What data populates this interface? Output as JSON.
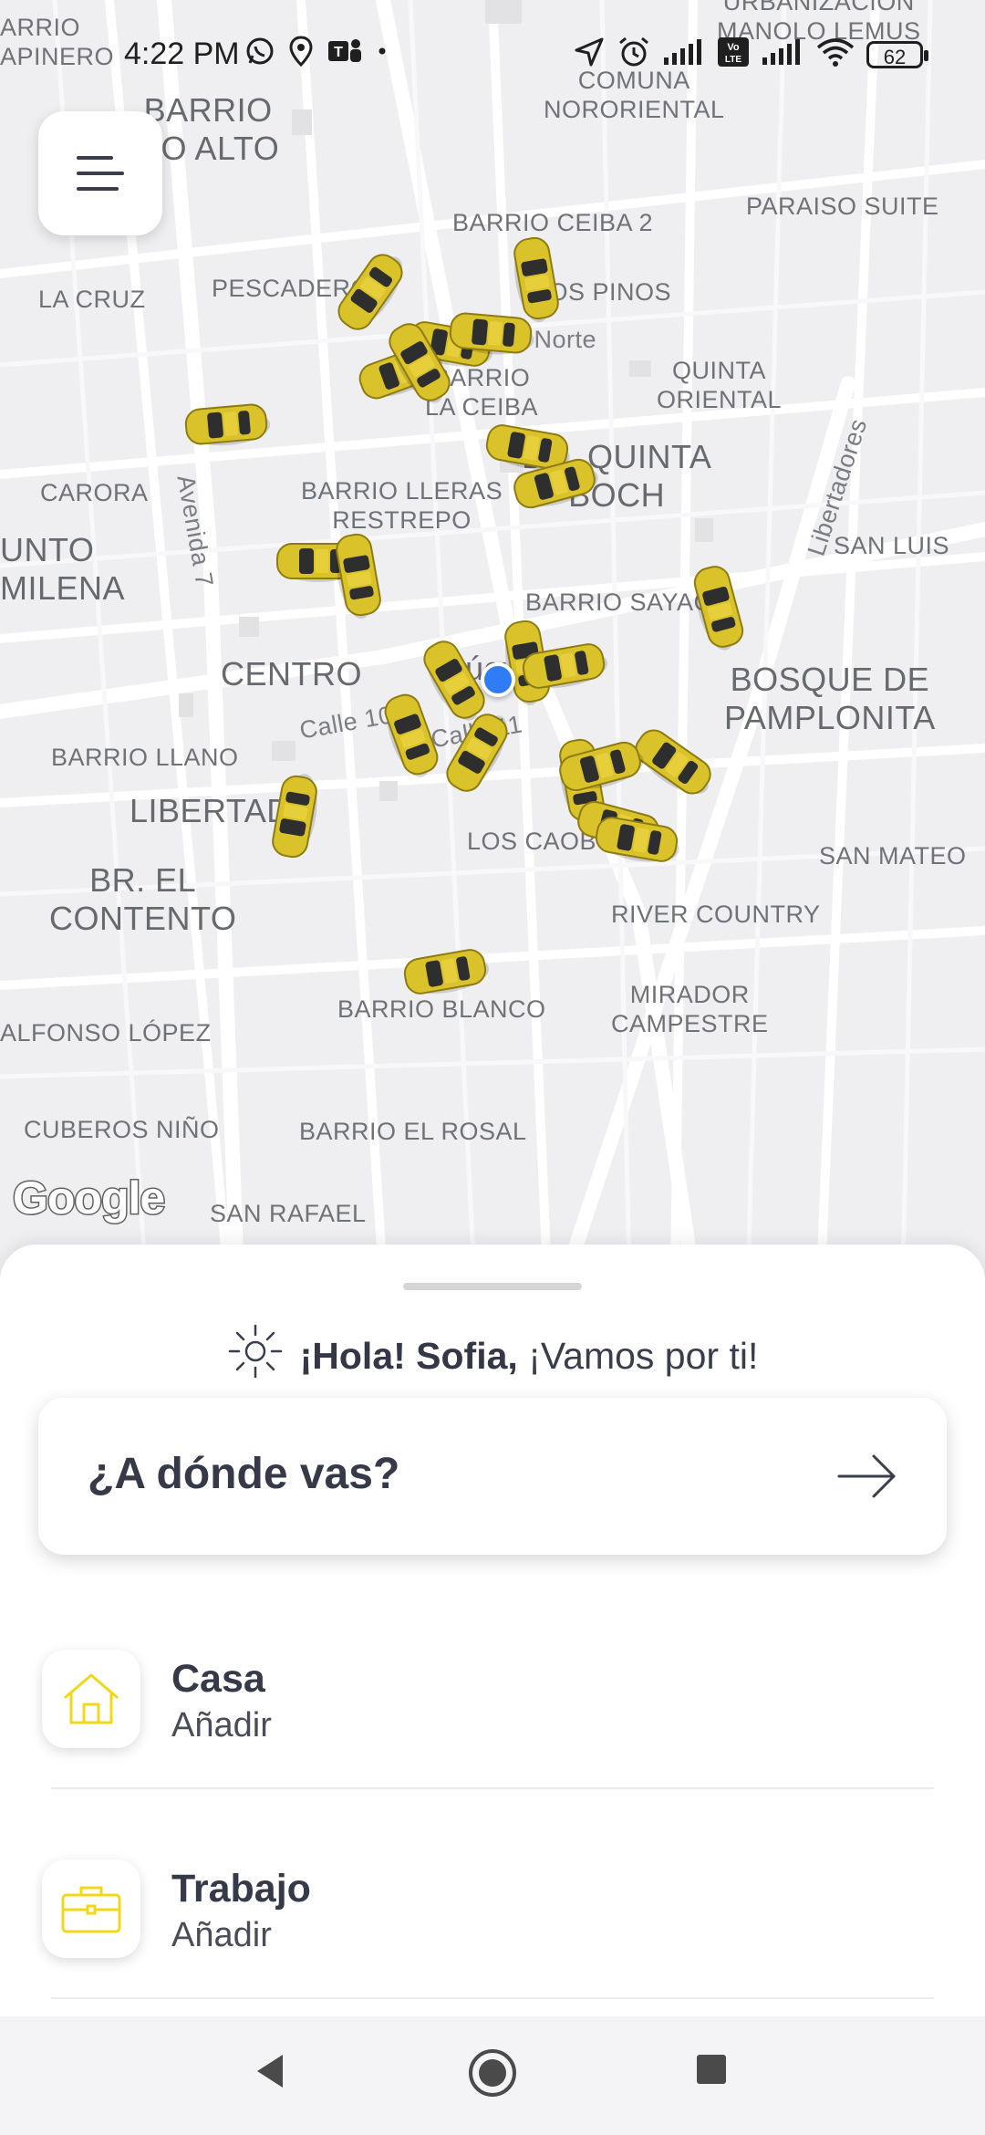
{
  "status_bar": {
    "time": "4:22 PM",
    "battery": "62",
    "left_icons": [
      "whatsapp-icon",
      "location-pin-icon",
      "teams-icon",
      "dot-icon"
    ],
    "right_icons": [
      "navigation-arrow-icon",
      "alarm-icon",
      "signal-icon",
      "volte-icon",
      "signal-icon",
      "wifi-icon",
      "battery-icon"
    ]
  },
  "map": {
    "labels": [
      {
        "text": "ARRIO\nAPINERO"
      },
      {
        "text": "BARRIO\nRO ALTO"
      },
      {
        "text": "COMUNA\nNORORIENTAL"
      },
      {
        "text": "URBANIZACION\nMANOLO LEMUS"
      },
      {
        "text": "PARAISO SUITE"
      },
      {
        "text": "BARRIO CEIBA 2"
      },
      {
        "text": "LA CRUZ"
      },
      {
        "text": "PESCADERO"
      },
      {
        "text": "LOS PINOS"
      },
      {
        "text": "Calle 2 Norte"
      },
      {
        "text": "QUINTA\nORIENTAL"
      },
      {
        "text": "BARRIO\nLA CEIBA"
      },
      {
        "text": "BR. QUINTA\nBOCH"
      },
      {
        "text": "CARORA"
      },
      {
        "text": "BARRIO LLERAS\nRESTREPO"
      },
      {
        "text": "Avenida 7"
      },
      {
        "text": "Libertadores"
      },
      {
        "text": "UNTO\nMILENA"
      },
      {
        "text": "SAN LUIS"
      },
      {
        "text": "BARRIO SAYAGO"
      },
      {
        "text": "CENTRO"
      },
      {
        "text": "úcuta"
      },
      {
        "text": "BOSQUE DE\nPAMPLONITA"
      },
      {
        "text": "Calle 10"
      },
      {
        "text": "Calle 11"
      },
      {
        "text": "BARRIO LLANO"
      },
      {
        "text": "LIBERTAD"
      },
      {
        "text": "LOS CAOBOS"
      },
      {
        "text": "SAN MATEO"
      },
      {
        "text": "BR. EL\nCONTENTO"
      },
      {
        "text": "RIVER COUNTRY"
      },
      {
        "text": "MIRADOR\nCAMPESTRE"
      },
      {
        "text": "BARRIO BLANCO"
      },
      {
        "text": "ALFONSO LÓPEZ"
      },
      {
        "text": "CUBEROS NIÑO"
      },
      {
        "text": "BARRIO EL ROSAL"
      },
      {
        "text": "SAN RAFAEL"
      }
    ],
    "google_logo": "Google",
    "taxi_count": 24
  },
  "sheet": {
    "greeting_name": "¡Hola! Sofia,",
    "greeting_rest": " ¡Vamos por ti!",
    "destination_label": "¿A dónde vas?",
    "places": [
      {
        "title": "Casa",
        "subtitle": "Añadir",
        "icon": "house-icon"
      },
      {
        "title": "Trabajo",
        "subtitle": "Añadir",
        "icon": "briefcase-icon"
      }
    ]
  },
  "colors": {
    "accent_yellow": "#f2d81c",
    "text_dark": "#363a48",
    "user_dot": "#2f7cf6",
    "taxi_yellow": "#d9c22a"
  }
}
